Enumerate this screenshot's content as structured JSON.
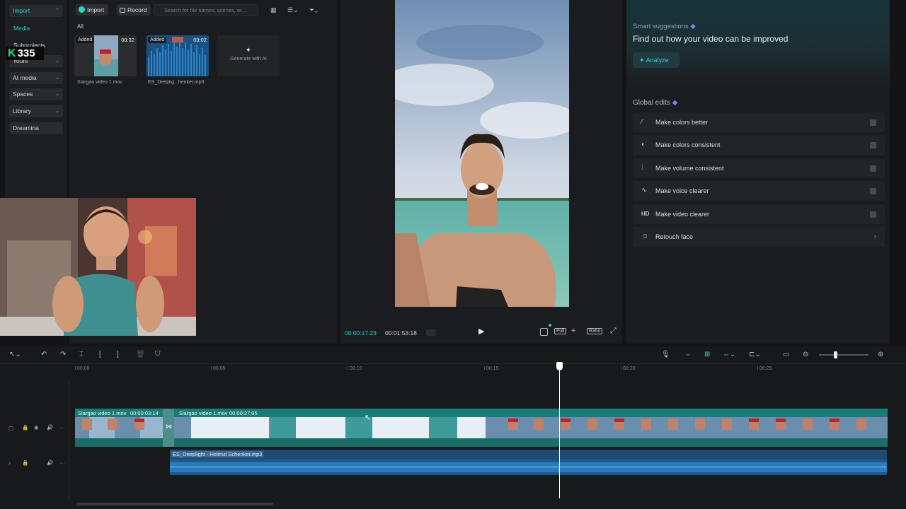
{
  "nav": {
    "import": "Import",
    "media": "Media",
    "subprojects": "Subprojects",
    "yours": "Yours",
    "ai_media": "AI media",
    "spaces": "Spaces",
    "library": "Library",
    "dreamina": "Dreamina"
  },
  "overlay_badge": {
    "value": "335"
  },
  "media_toolbar": {
    "import": "Import",
    "record": "Record",
    "search_placeholder": "Search for file names, scenes, or..."
  },
  "media": {
    "filter": "All",
    "items": [
      {
        "tag": "Added",
        "duration": "00:32",
        "name": "Siargao video 1.mov"
      },
      {
        "tag": "Added",
        "duration": "03:02",
        "name": "ES_Deeplig...henker.mp3"
      }
    ],
    "generate_ai": "Generate with AI"
  },
  "player": {
    "current_time": "00:00:17:23",
    "total_time": "00:01:53:18",
    "full": "Full",
    "ratio": "Ratio"
  },
  "right_panel": {
    "smart_title": "Smart suggestions",
    "smart_heading": "Find out how your video can be improved",
    "analyze": "Analyze",
    "global_title": "Global edits",
    "items": [
      {
        "label": "Make colors better",
        "icon": "magic-wand-icon"
      },
      {
        "label": "Make colors consistent",
        "icon": "palette-icon"
      },
      {
        "label": "Make volume consistent",
        "icon": "sliders-icon"
      },
      {
        "label": "Make voice clearer",
        "icon": "voice-wave-icon"
      },
      {
        "label": "Make video clearer",
        "icon": "hd-icon"
      },
      {
        "label": "Retouch face",
        "icon": "face-icon"
      }
    ],
    "hd": "HD"
  },
  "timeline": {
    "ruler": [
      "00:00",
      "00:05",
      "00:10",
      "00:15",
      "00:20",
      "00:25"
    ],
    "clip1_name": "Siargao video 1.mov",
    "clip1_dur": "00:00:03:14",
    "clip2_name": "Siargao video 1.mov",
    "clip2_dur": "00:00:27:05",
    "audio_name": "ES_Deeplight - Helmut Schenker.mp3"
  },
  "colors": {
    "accent": "#2ad3c3",
    "video_track": "#1a7c78",
    "audio_track": "#1d4f7a",
    "premium": "#8a7cf0"
  }
}
